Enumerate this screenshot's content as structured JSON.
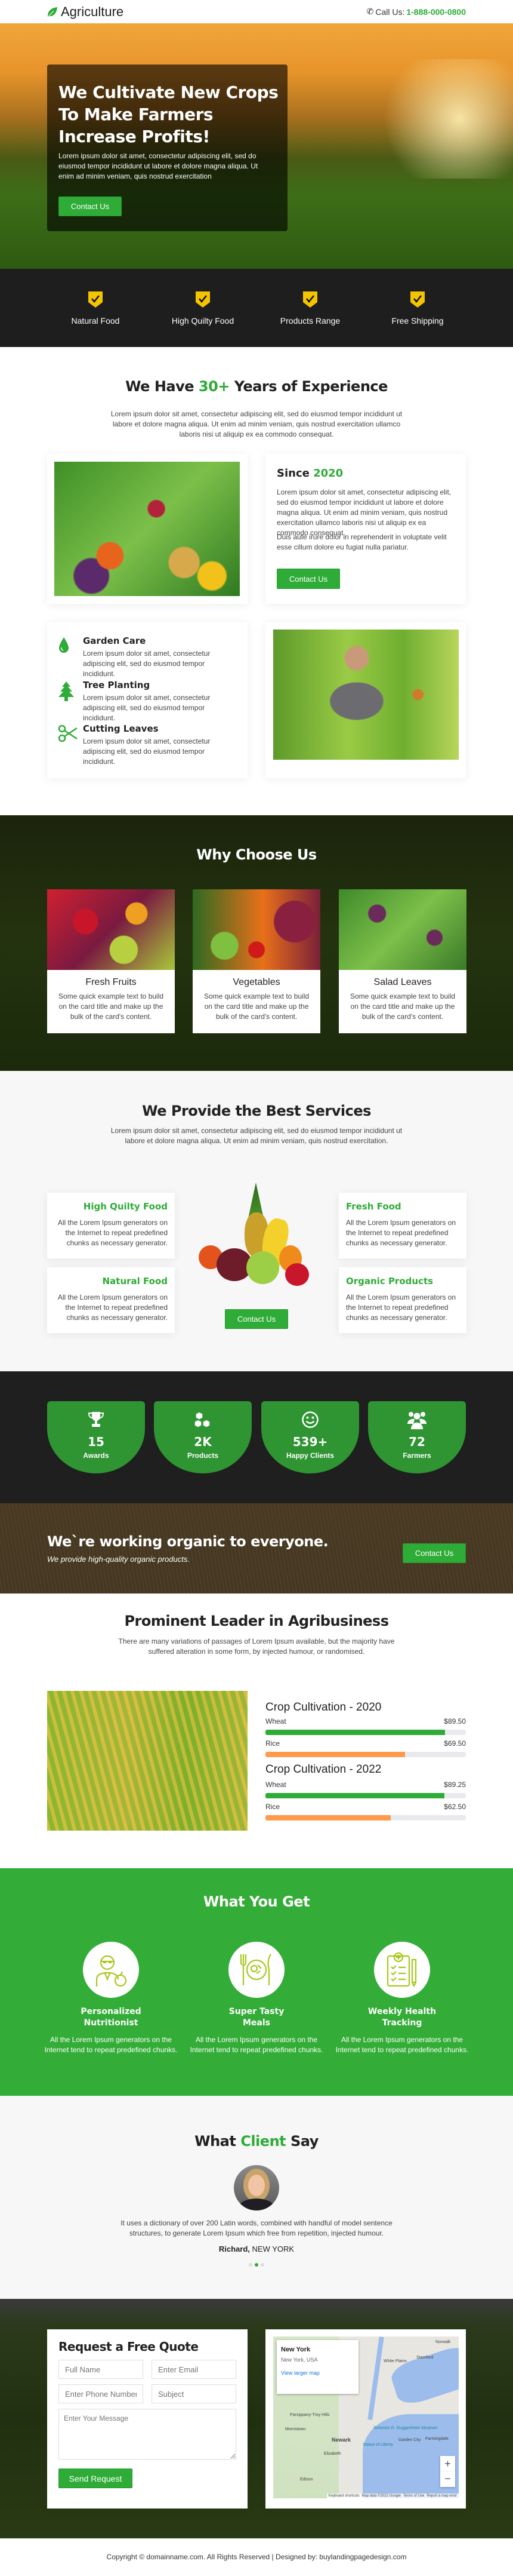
{
  "colors": {
    "accent": "#2eac37",
    "dark": "#1f1f1f",
    "shield": "#f5c400",
    "orange": "#ff9a4d",
    "icon_line": "#a8c81a"
  },
  "header": {
    "logo": "Agriculture",
    "call_label": "Call Us:",
    "phone": "1-888-000-0800"
  },
  "hero": {
    "title": "We Cultivate New Crops To Make Farmers Increase Profits!",
    "text": "Lorem ipsum dolor sit amet, consectetur adipiscing elit, sed do eiusmod tempor incididunt ut labore et dolore magna aliqua. Ut enim ad minim veniam, quis nostrud exercitation",
    "button": "Contact Us"
  },
  "features": [
    {
      "label": "Natural Food",
      "icon": "shield-check"
    },
    {
      "label": "High Quilty Food",
      "icon": "shield-check"
    },
    {
      "label": "Products Range",
      "icon": "shield-check"
    },
    {
      "label": "Free Shipping",
      "icon": "shield-check"
    }
  ],
  "experience": {
    "title_pre": "We Have ",
    "title_hl": "30+",
    "title_post": " Years of Experience",
    "text": "Lorem ipsum dolor sit amet, consectetur adipiscing elit, sed do eiusmod tempor incididunt ut labore et dolore magna aliqua. Ut enim ad minim veniam, quis nostrud exercitation ullamco laboris nisi ut aliquip ex ea commodo consequat.",
    "since_pre": "Since ",
    "since_year": "2020",
    "since_text1": "Lorem ipsum dolor sit amet, consectetur adipiscing elit, sed do eiusmod tempor incididunt ut labore et dolore magna aliqua. Ut enim ad minim veniam, quis nostrud exercitation ullamco laboris nisi ut aliquip ex ea commodo consequat.",
    "since_text2": "Duis aute irure dolor in reprehenderit in voluptate velit esse cillum dolore eu fugiat nulla pariatur.",
    "button": "Contact Us",
    "items": [
      {
        "title": "Garden Care",
        "text": "Lorem ipsum dolor sit amet, consectetur adipiscing elit, sed do eiusmod tempor incididunt.",
        "icon": "drop"
      },
      {
        "title": "Tree Planting",
        "text": "Lorem ipsum dolor sit amet, consectetur adipiscing elit, sed do eiusmod tempor incididunt.",
        "icon": "tree"
      },
      {
        "title": "Cutting Leaves",
        "text": "Lorem ipsum dolor sit amet, consectetur adipiscing elit, sed do eiusmod tempor incididunt.",
        "icon": "scissors"
      }
    ]
  },
  "why": {
    "title": "Why Choose Us",
    "cards": [
      {
        "title": "Fresh Fruits",
        "text": "Some quick example text to build on the card title and make up the bulk of the card's content."
      },
      {
        "title": "Vegetables",
        "text": "Some quick example text to build on the card title and make up the bulk of the card's content."
      },
      {
        "title": "Salad Leaves",
        "text": "Some quick example text to build on the card title and make up the bulk of the card's content."
      }
    ]
  },
  "services": {
    "title": "We Provide the Best Services",
    "text": "Lorem ipsum dolor sit amet, consectetur adipiscing elit, sed do eiusmod tempor incididunt ut labore et dolore magna aliqua. Ut enim ad minim veniam, quis nostrud exercitation.",
    "button": "Contact Us",
    "items": [
      {
        "title": "High Quilty Food",
        "text": "All the Lorem Ipsum generators on the Internet to repeat predefined chunks as necessary generator."
      },
      {
        "title": "Natural Food",
        "text": "All the Lorem Ipsum generators on the Internet to repeat predefined chunks as necessary generator."
      },
      {
        "title": "Fresh Food",
        "text": "All the Lorem Ipsum generators on the Internet to repeat predefined chunks as necessary generator."
      },
      {
        "title": "Organic Products",
        "text": "All the Lorem Ipsum generators on the Internet to repeat predefined chunks as necessary generator."
      }
    ]
  },
  "stats": [
    {
      "value": "15",
      "label": "Awards",
      "icon": "trophy"
    },
    {
      "value": "2K",
      "label": "Products",
      "icon": "cubes"
    },
    {
      "value": "539+",
      "label": "Happy Clients",
      "icon": "smiley"
    },
    {
      "value": "72",
      "label": "Farmers",
      "icon": "users"
    }
  ],
  "organic": {
    "title": "We`re working organic to everyone.",
    "subtitle": "We provide high-quality organic products.",
    "button": "Contact Us"
  },
  "leader": {
    "title": "Prominent Leader in Agribusiness",
    "text": "There are many variations of passages of Lorem Ipsum available, but the majority have suffered alteration in some form, by injected humour, or randomised.",
    "groups": [
      {
        "title": "Crop Cultivation - 2020",
        "rows": [
          {
            "label": "Wheat",
            "value": "$89.50",
            "percent": 89.5,
            "color": "#2eac37"
          },
          {
            "label": "Rice",
            "value": "$69.50",
            "percent": 69.5,
            "color": "#ff9a4d"
          }
        ]
      },
      {
        "title": "Crop Cultivation - 2022",
        "rows": [
          {
            "label": "Wheat",
            "value": "$89.25",
            "percent": 89.25,
            "color": "#2eac37"
          },
          {
            "label": "Rice",
            "value": "$62.50",
            "percent": 62.5,
            "color": "#ff9a4d"
          }
        ]
      }
    ]
  },
  "get": {
    "title": "What You Get",
    "items": [
      {
        "title": "Personalized Nutritionist",
        "text": "All the Lorem Ipsum generators on the Internet tend to repeat predefined chunks.",
        "icon": "nutritionist"
      },
      {
        "title": "Super Tasty Meals",
        "text": "All the Lorem Ipsum generators on the Internet tend to repeat predefined chunks.",
        "icon": "meal"
      },
      {
        "title": "Weekly Health Tracking",
        "text": "All the Lorem Ipsum generators on the Internet tend to repeat predefined chunks.",
        "icon": "clipboard"
      }
    ]
  },
  "testimonial": {
    "title_pre": "What ",
    "title_hl": "Client",
    "title_post": " Say",
    "quote": "It uses a dictionary of over 200 Latin words, combined with handful of model sentence structures, to generate Lorem Ipsum which free from repetition, injected humour.",
    "name": "Richard,",
    "city": "NEW YORK",
    "active_dot": 1
  },
  "quote": {
    "title": "Request a Free Quote",
    "full_name": "Full Name",
    "email": "Enter Email",
    "phone": "Enter Phone Number",
    "subject": "Subject",
    "message": "Enter Your Message",
    "button": "Send Request"
  },
  "map": {
    "place": "New York",
    "address": "New York, USA",
    "link": "View larger map",
    "labels": [
      "Norwalk",
      "Stamford",
      "White Plains",
      "Parsippany-Troy Hills",
      "Morristown",
      "Newark",
      "Elizabeth",
      "Edison",
      "Middletown Township",
      "Garden City",
      "Farmingdale",
      "Statue of Liberty",
      "Solomon R. Guggenheim Museum"
    ],
    "attribution": [
      "Keyboard shortcuts",
      "Map data ©2022 Google",
      "Terms of Use",
      "Report a map error"
    ]
  },
  "footer": {
    "text": "Copyright © domainname.com. All Rights Reserved | Designed by: buylandingpagedesign.com"
  }
}
